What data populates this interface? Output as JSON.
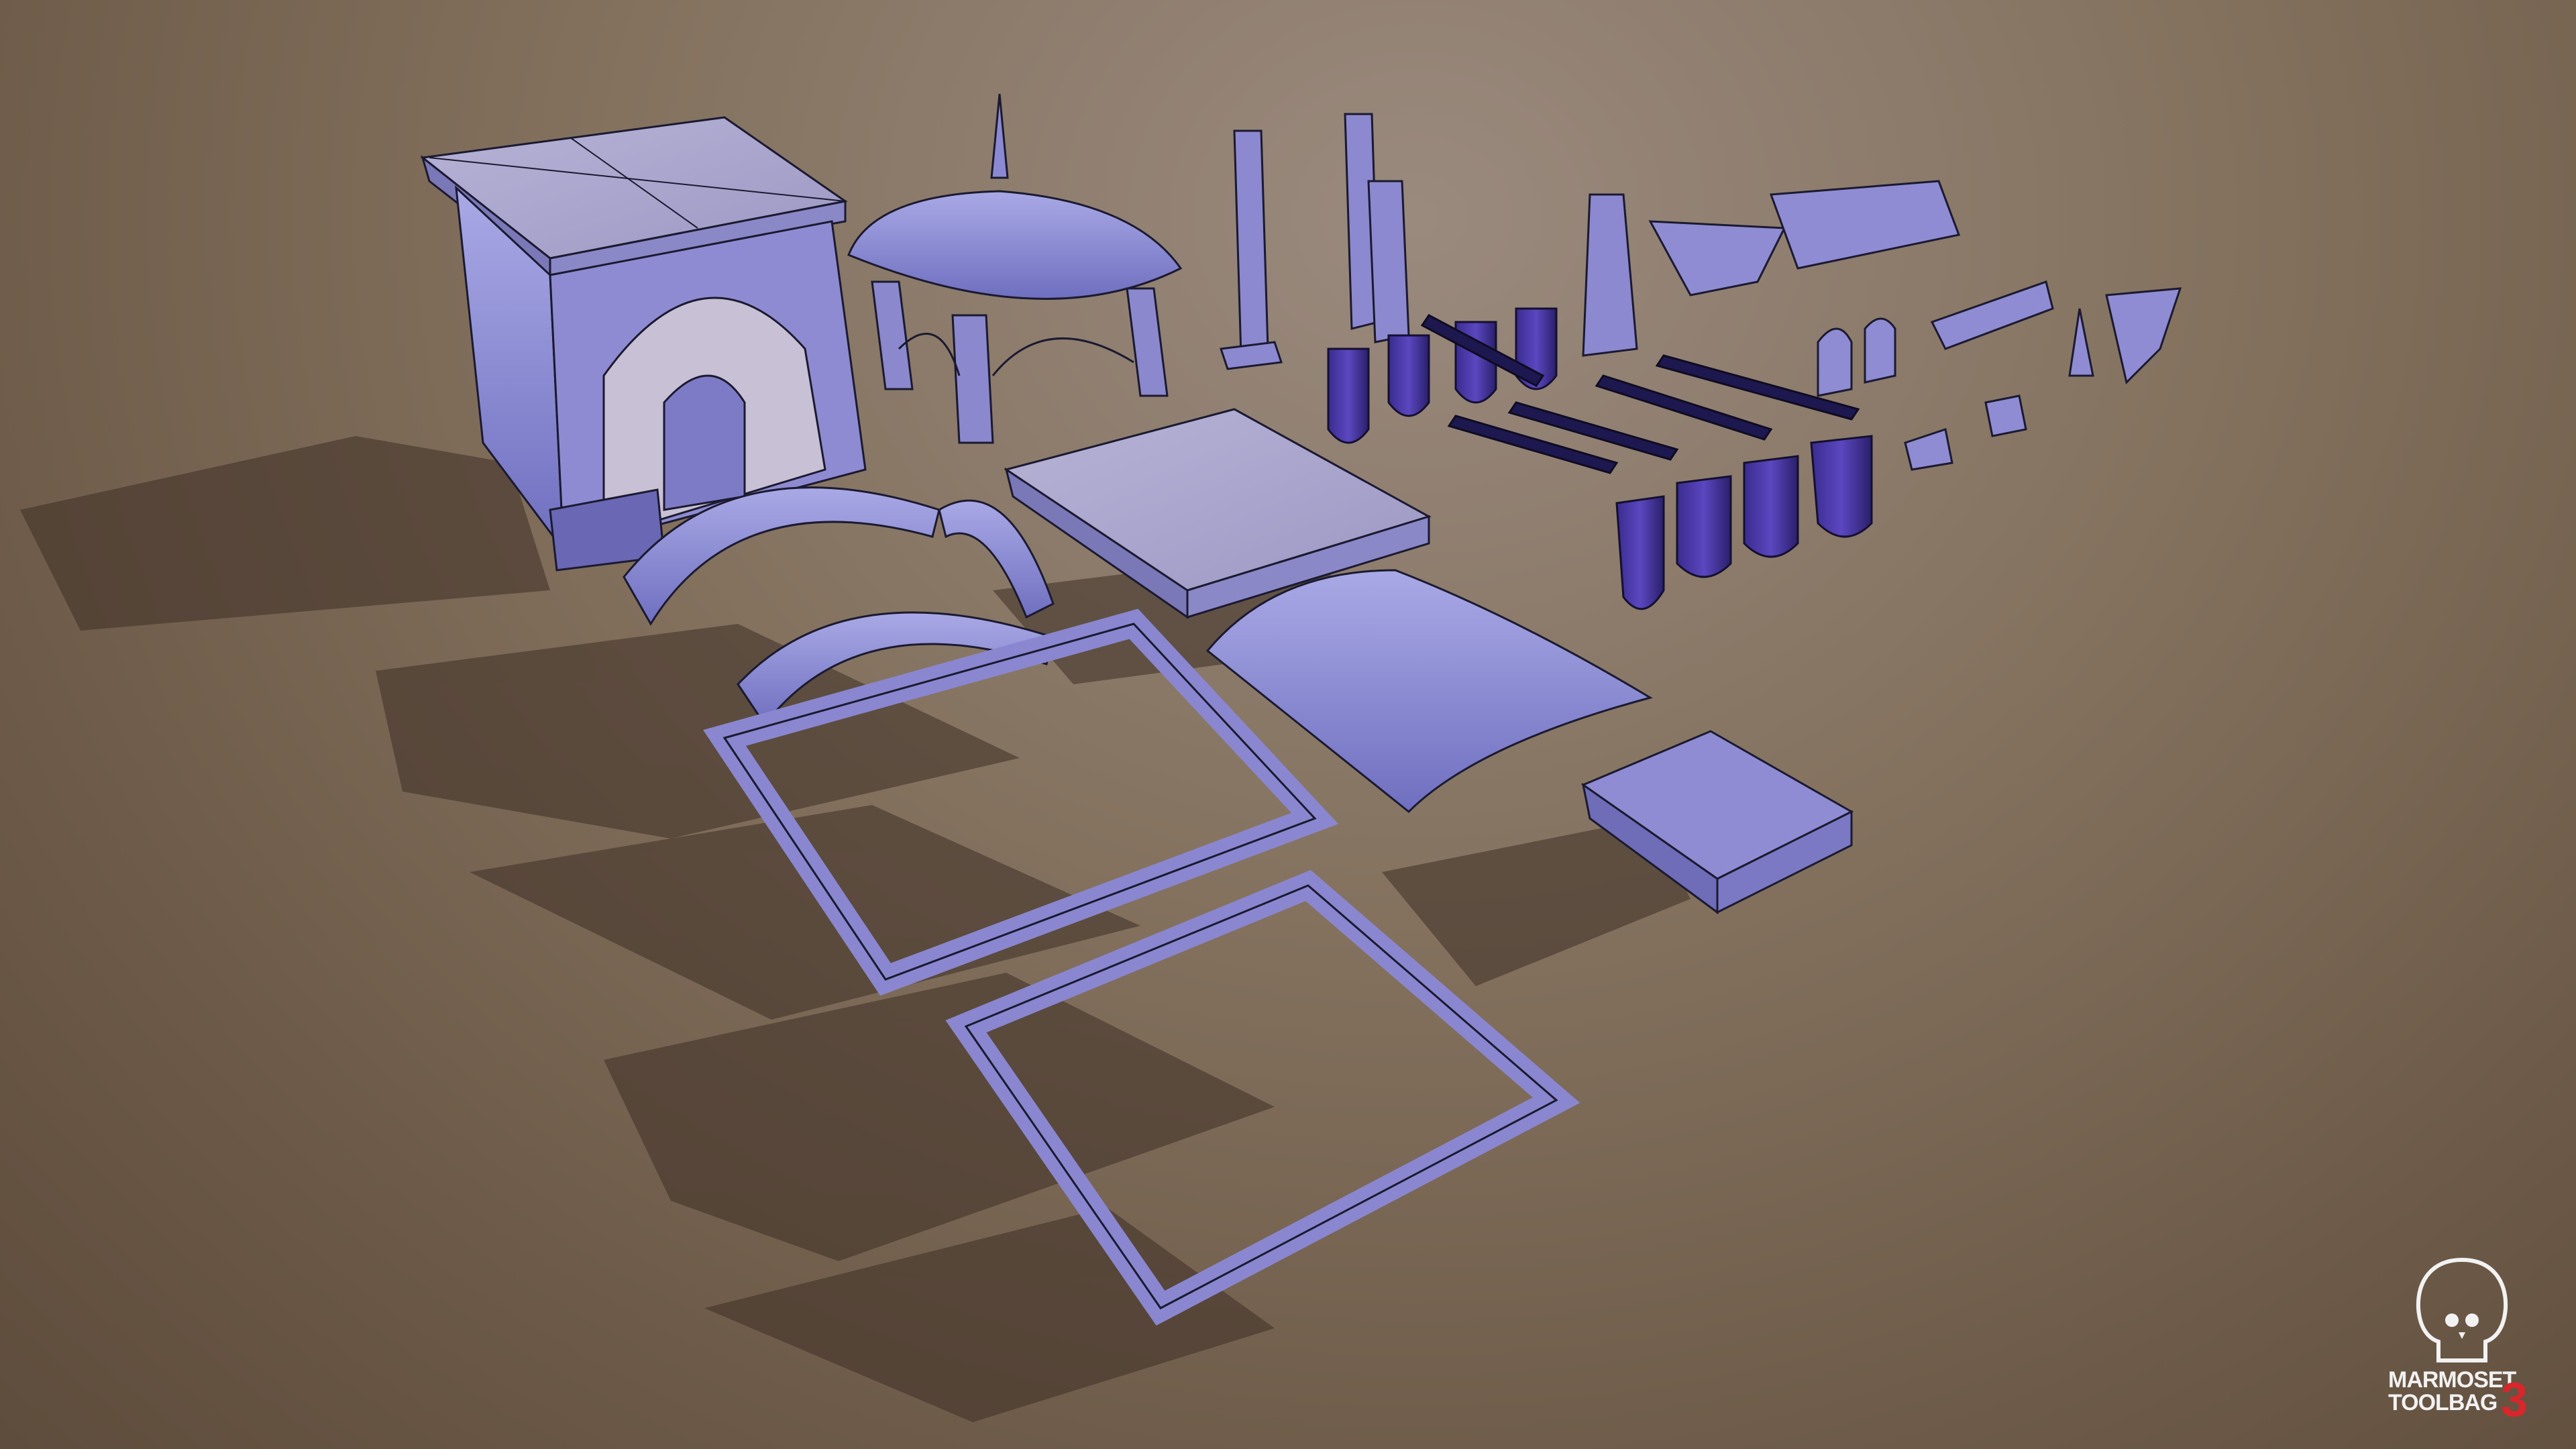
{
  "watermark": {
    "brand_line1": "MARMOSET",
    "brand_line2": "TOOLBAG",
    "version": "3",
    "logo_icon": "skull-icon",
    "version_color": "#d8262b"
  },
  "scene": {
    "background_color": "#84725f",
    "asset_color": "#8f8fd8",
    "asset_dark_color": "#3b2f8a",
    "wire_color": "#1b1a30"
  }
}
